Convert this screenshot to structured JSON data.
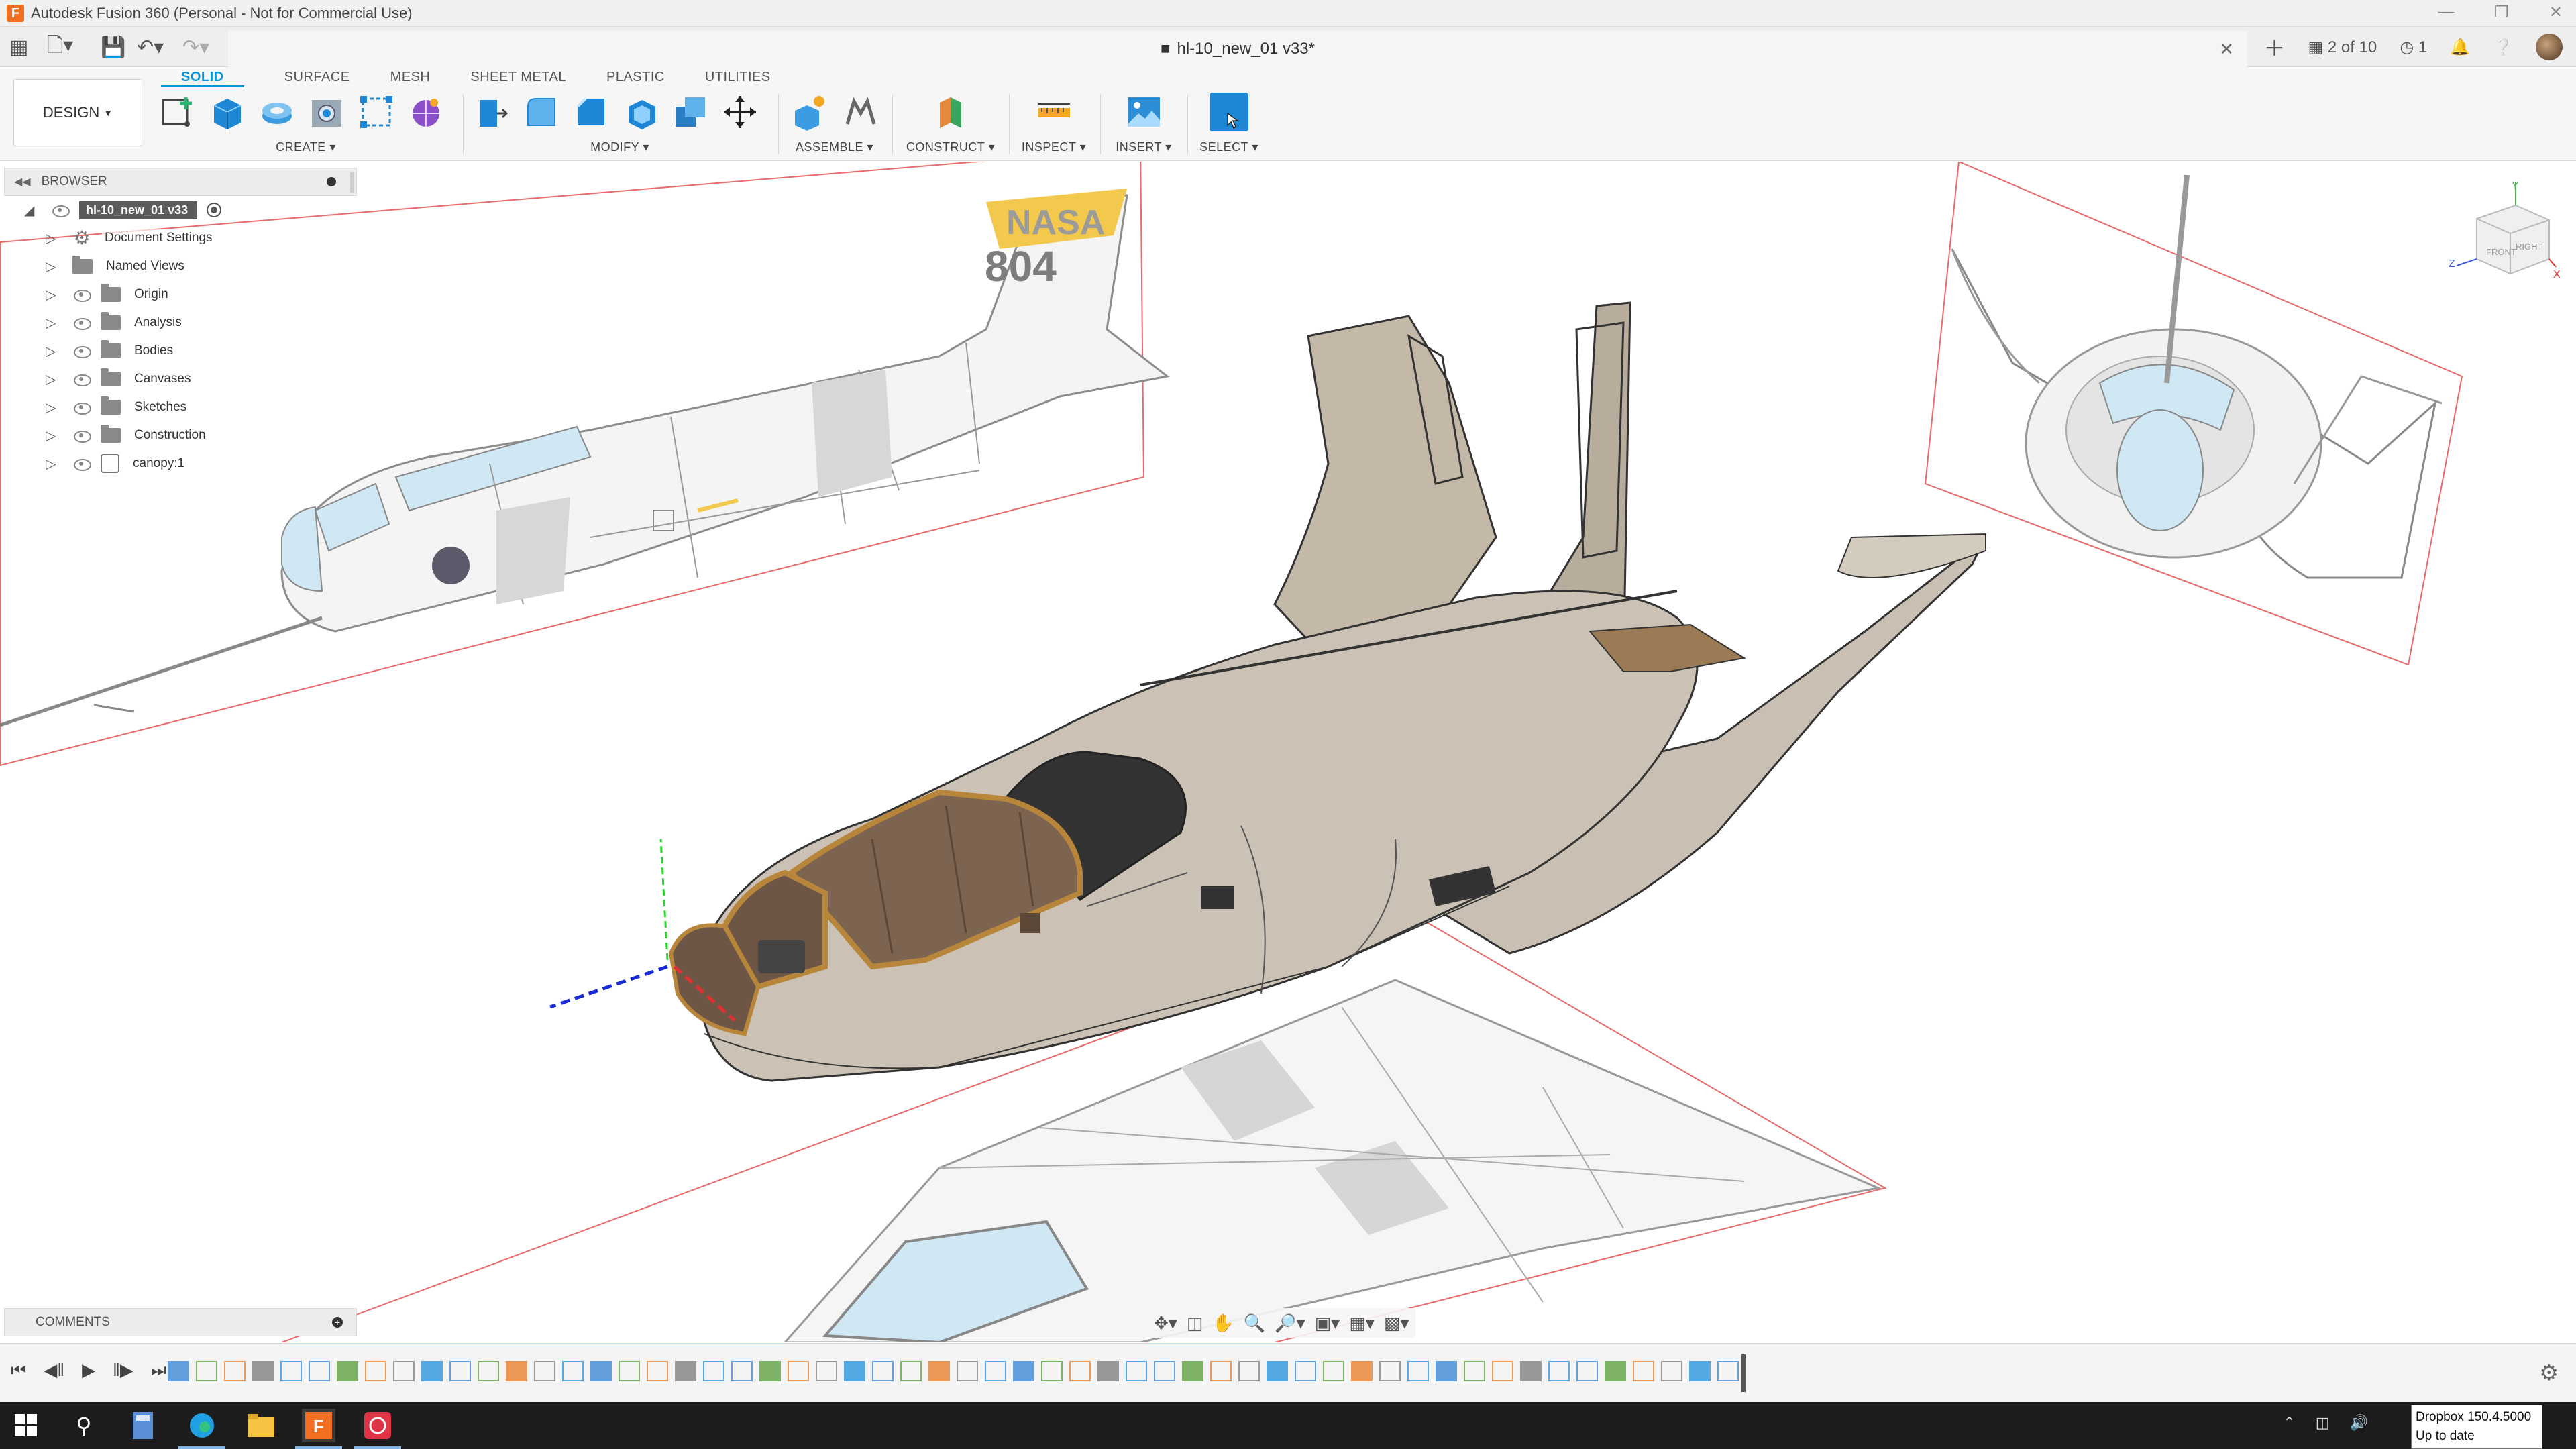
{
  "window": {
    "title": "Autodesk Fusion 360 (Personal - Not for Commercial Use)"
  },
  "document": {
    "tab_title": "hl-10_new_01 v33*",
    "jobs_status": "2 of 10",
    "notifications_count": "1"
  },
  "ribbon": {
    "workspace": "DESIGN",
    "tabs": [
      {
        "label": "SOLID",
        "active": true
      },
      {
        "label": "SURFACE",
        "active": false
      },
      {
        "label": "MESH",
        "active": false
      },
      {
        "label": "SHEET METAL",
        "active": false
      },
      {
        "label": "PLASTIC",
        "active": false
      },
      {
        "label": "UTILITIES",
        "active": false
      }
    ],
    "groups": {
      "create": "CREATE",
      "modify": "MODIFY",
      "assemble": "ASSEMBLE",
      "construct": "CONSTRUCT",
      "inspect": "INSPECT",
      "insert": "INSERT",
      "select": "SELECT"
    }
  },
  "browser": {
    "title": "BROWSER",
    "root": "hl-10_new_01 v33",
    "items": [
      {
        "label": "Document Settings",
        "icon": "gear-icon"
      },
      {
        "label": "Named Views",
        "icon": "folder-icon"
      },
      {
        "label": "Origin",
        "icon": "folder-icon"
      },
      {
        "label": "Analysis",
        "icon": "folder-icon"
      },
      {
        "label": "Bodies",
        "icon": "folder-icon"
      },
      {
        "label": "Canvases",
        "icon": "folder-icon"
      },
      {
        "label": "Sketches",
        "icon": "folder-icon"
      },
      {
        "label": "Construction",
        "icon": "folder-icon"
      },
      {
        "label": "canopy:1",
        "icon": "component-icon"
      }
    ]
  },
  "canvas": {
    "tail_text": "NASA",
    "tail_number": "804"
  },
  "viewcube": {
    "right": "RIGHT",
    "front": "FRONT",
    "axis_y": "Y",
    "axis_z": "Z",
    "axis_x": "X"
  },
  "comments": {
    "title": "COMMENTS"
  },
  "taskbar": {
    "tooltip_line1": "Dropbox 150.4.5000",
    "tooltip_line2": "Up to date"
  },
  "colors": {
    "accent": "#0696d7",
    "fuselage": "#c9c0b3",
    "canopy_frame": "#b8863b",
    "sketch_plane": "#e86a6a",
    "canvas_glass": "#cfe8f4"
  }
}
